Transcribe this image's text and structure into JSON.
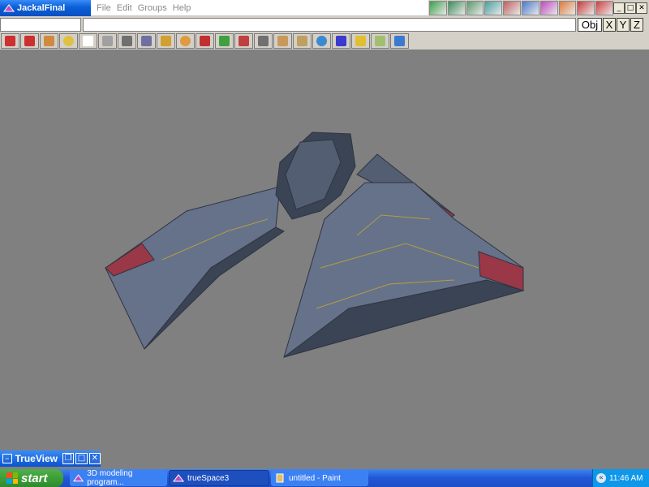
{
  "window": {
    "title": "JackalFinal",
    "icon": "truespace-app-icon"
  },
  "menu": {
    "items": [
      "File",
      "Edit",
      "Groups",
      "Help"
    ]
  },
  "top_tools": [
    {
      "icon": "look-around-icon",
      "color": "#3aa048"
    },
    {
      "icon": "fly-view-icon",
      "color": "#3c8c5a"
    },
    {
      "icon": "bank-view-icon",
      "color": "#5a9a6a"
    },
    {
      "icon": "rotate-view-icon",
      "color": "#4aa0a0"
    },
    {
      "icon": "perspective-icon",
      "color": "#c06060"
    },
    {
      "icon": "render-area-icon",
      "color": "#4a7acc"
    },
    {
      "icon": "render-scene-icon",
      "color": "#c04ac0"
    },
    {
      "icon": "render-object-icon",
      "color": "#e07a3a"
    },
    {
      "icon": "material-library-icon",
      "color": "#c83a3a"
    },
    {
      "icon": "help-icon",
      "color": "#d04040"
    }
  ],
  "status_bar": {
    "left_text": "",
    "main_text": ""
  },
  "axis_buttons": {
    "obj": "Obj",
    "x": "X",
    "y": "Y",
    "z": "Z"
  },
  "main_toolbar": [
    {
      "icon": "undo-icon",
      "color": "#cc3030"
    },
    {
      "icon": "erase-icon",
      "color": "#cc3030"
    },
    {
      "icon": "add-object-icon",
      "color": "#d08a40"
    },
    {
      "icon": "light-icon",
      "color": "#e0c040"
    },
    {
      "icon": "select-arrow-icon",
      "color": "#ffffff"
    },
    {
      "icon": "navigation-icon",
      "color": "#a0a0a0"
    },
    {
      "icon": "move-down-icon",
      "color": "#707070"
    },
    {
      "icon": "object-tool-icon",
      "color": "#7070a0"
    },
    {
      "icon": "deform-icon",
      "color": "#d0a030"
    },
    {
      "icon": "sphere-icon",
      "color": "#e09a40"
    },
    {
      "icon": "boolean-icon",
      "color": "#c03030"
    },
    {
      "icon": "sweep-icon",
      "color": "#40a040"
    },
    {
      "icon": "pivot-icon",
      "color": "#c04040"
    },
    {
      "icon": "path-icon",
      "color": "#707070"
    },
    {
      "icon": "paint-brush-icon",
      "color": "#c89a5a"
    },
    {
      "icon": "material-icon",
      "color": "#c0a060"
    },
    {
      "icon": "color-balls-icon",
      "color": "#3a8ad0"
    },
    {
      "icon": "grid-icon",
      "color": "#3a3ad0"
    },
    {
      "icon": "animation-icon",
      "color": "#e0c030"
    },
    {
      "icon": "scene-icon",
      "color": "#a0c070"
    },
    {
      "icon": "3d-view-icon",
      "color": "#3a7ad0"
    }
  ],
  "viewport": {
    "model": "spaceship-model",
    "colors": {
      "hull": "#535e72",
      "hull_light": "#66718a",
      "hull_dark": "#3b4454",
      "accent": "#9a3848",
      "detail": "#b0a040"
    }
  },
  "trueview": {
    "title": "TrueView",
    "btn_restore": "❐",
    "btn_max": "□",
    "btn_close": "✕"
  },
  "taskbar": {
    "start_label": "start",
    "tasks": [
      {
        "label": "3D modeling program..."
      },
      {
        "label": "trueSpace3"
      },
      {
        "label": "untitled - Paint"
      }
    ],
    "tray_icon": "«",
    "clock": "11:46 AM"
  }
}
